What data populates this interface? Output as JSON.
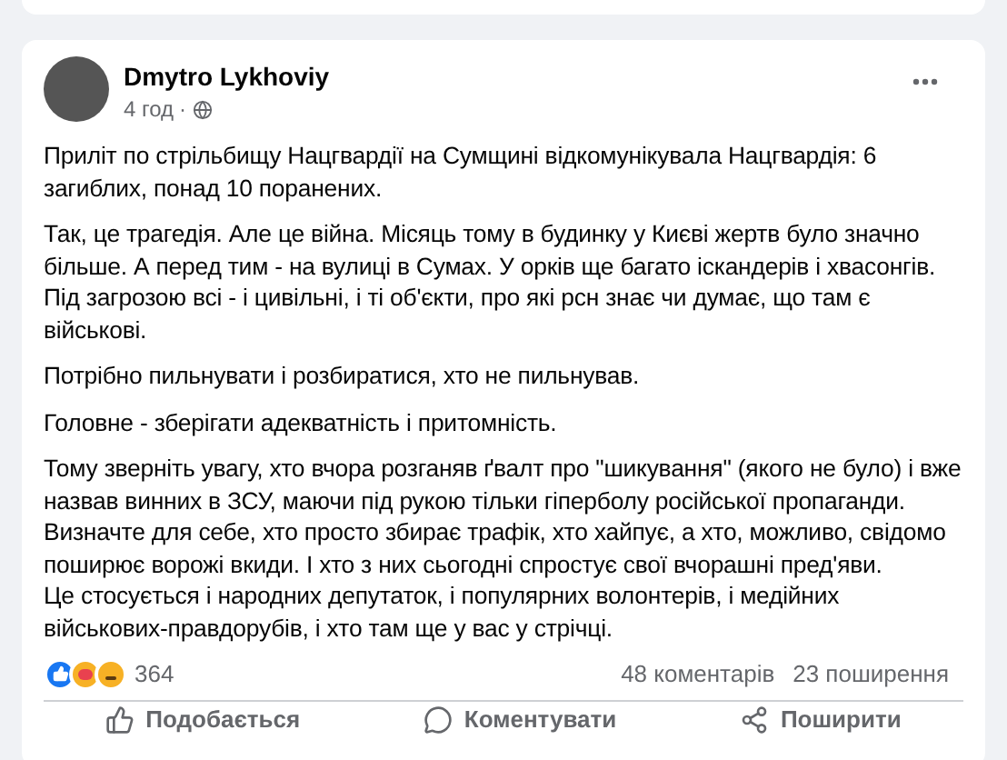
{
  "post": {
    "author": "Dmytro Lykhoviy",
    "time": "4 год",
    "separator": "·",
    "paragraphs": [
      {
        "lines": [
          "Приліт по стрільбищу Нацгвардії на Сумщині відкомунікувала Нацгвардія: 6 загиблих, понад 10 поранених."
        ]
      },
      {
        "lines": [
          "Так, це трагедія. Але це війна. Місяць тому в будинку у Києві жертв було значно більше. А перед тим - на вулиці в Сумах. У орків ще багато іскандерів і хвасонгів. Під загрозою всі - і цивільні, і ті об'єкти, про які рсн знає чи думає, що там є військові."
        ]
      },
      {
        "lines": [
          "Потрібно пильнувати і розбиратися, хто не пильнував."
        ]
      },
      {
        "lines": [
          "Головне - зберігати адекватність і притомність."
        ]
      },
      {
        "lines": [
          "Тому зверніть увагу, хто вчора розганяв ґвалт про \"шикування\" (якого не було) і вже назвав винних в ЗСУ, маючи під рукою тільки гіперболу російської пропаганди.",
          "Визначте для себе, хто просто збирає трафік, хто хайпує, а хто, можливо, свідомо поширює ворожі вкиди. І хто з них сьогодні спростує свої вчорашні пред'яви.",
          "Це стосується і народних депутаток, і популярних волонтерів, і медійних військових-правдорубів, і хто там ще у вас у стрічці."
        ]
      }
    ],
    "reactions": {
      "count": "364"
    },
    "comments": "48 коментарів",
    "shares": "23 поширення",
    "actions": [
      {
        "kind": "like",
        "label": "Подобається"
      },
      {
        "kind": "comment",
        "label": "Коментувати"
      },
      {
        "kind": "share",
        "label": "Поширити"
      }
    ]
  }
}
